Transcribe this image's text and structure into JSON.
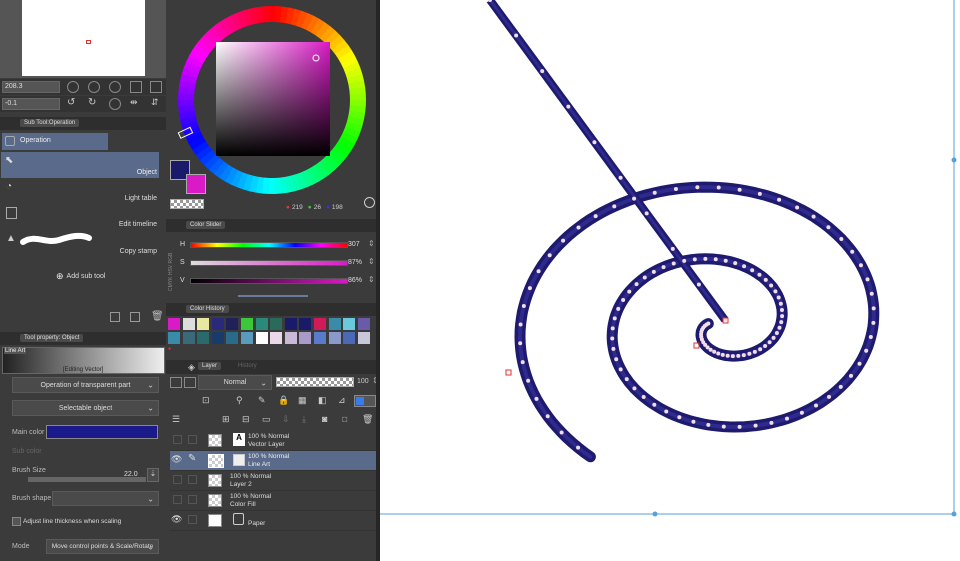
{
  "navigator": {
    "zoom": "208.3",
    "angle": "-0.1"
  },
  "subtool_panel": {
    "title": "Sub Tool:Operation",
    "tab": "Operation",
    "items": [
      {
        "label": "Object"
      },
      {
        "label": "Light table"
      },
      {
        "label": "Edit timeline"
      },
      {
        "label": "Copy stamp"
      }
    ],
    "add_sub_tool": "Add sub tool"
  },
  "tool_property": {
    "title": "Tool property: Object",
    "line_art_label": "Line Art",
    "editing_label": "[Editing Vector]",
    "operation_dropdown": "Operation of transparent part",
    "selectable_dropdown": "Selectable object",
    "main_color_label": "Main color",
    "sub_color_label": "Sub color",
    "brush_size_label": "Brush Size",
    "brush_size_value": "22.0",
    "brush_shape_label": "Brush shape",
    "adjust_label": "Adjust line thickness when scaling",
    "mode_label": "Mode",
    "mode_value": "Move control points & Scale/Rotate",
    "main_color": "#1a1a8a"
  },
  "color_wheel": {
    "r": "219",
    "g": "26",
    "b": "198",
    "main_color": "#1a1a6b",
    "sub_color": "#d91ac6"
  },
  "color_slider": {
    "title": "Color Slider",
    "modes": [
      "RGB",
      "HSV",
      "CMYK"
    ],
    "sliders": [
      {
        "label": "H",
        "value": "307",
        "fill": 0.85
      },
      {
        "label": "S",
        "value": "87%",
        "fill": 0.87
      },
      {
        "label": "V",
        "value": "86%",
        "fill": 0.86
      }
    ]
  },
  "color_history": {
    "title": "Color History",
    "swatches": [
      "#d91ac6",
      "#dddddd",
      "#e8e8a0",
      "#2a2a7a",
      "#20205a",
      "#3ac83a",
      "#2a8a7a",
      "#2a6a5a",
      "#1a1a6b",
      "#1a1a6b",
      "#d01a5a",
      "#3a8aaa",
      "#6acadb",
      "#6a5aaa",
      "#3a8aaa",
      "#3a6a7a",
      "#2a6a6a",
      "#1a3a6a",
      "#2a6a8a",
      "#5a9aba",
      "#ffffff",
      "#e8d8e8",
      "#cab8d8",
      "#aa9ac8",
      "#5a7acb",
      "#8a9aca",
      "#4a6ab8",
      "#c8c8d8"
    ]
  },
  "layer_panel": {
    "tab_layer": "Layer",
    "tab_history": "History",
    "blend_mode": "Normal",
    "opacity": "100",
    "layers": [
      {
        "percent": "100 % Normal",
        "name": "Vector Layer",
        "visible": false,
        "selected": false
      },
      {
        "percent": "100 % Normal",
        "name": "Line Art",
        "visible": true,
        "selected": true
      },
      {
        "percent": "100 % Normal",
        "name": "Layer 2",
        "visible": false,
        "selected": false
      },
      {
        "percent": "100 % Normal",
        "name": "Color Fill",
        "visible": false,
        "selected": false
      },
      {
        "percent": "",
        "name": "Paper",
        "visible": true,
        "selected": false
      }
    ]
  },
  "canvas": {
    "stroke_color": "#1e1a6e",
    "point_color": "#f2dde8"
  }
}
